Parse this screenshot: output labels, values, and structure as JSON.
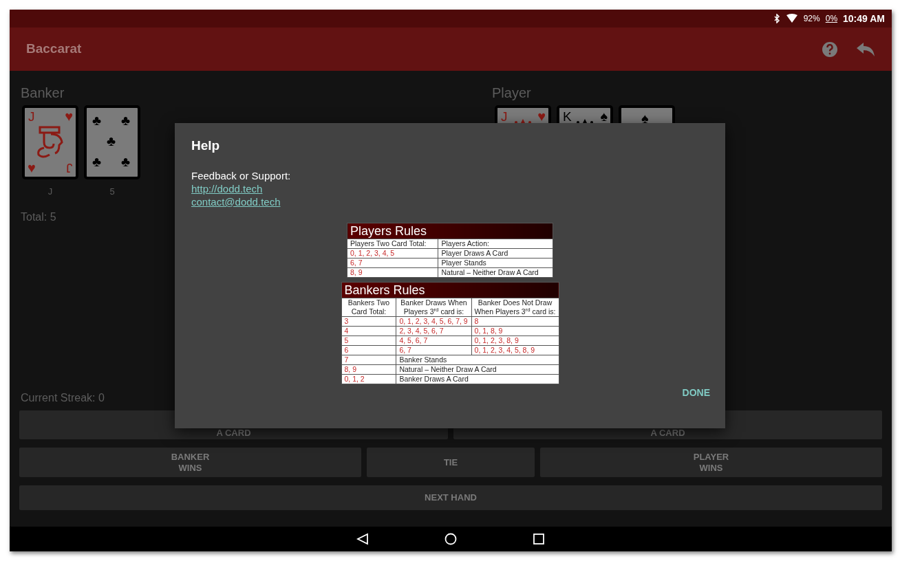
{
  "status_bar": {
    "battery": "92%",
    "data_usage": "0%",
    "time": "10:49 AM"
  },
  "app_bar": {
    "title": "Baccarat"
  },
  "banker": {
    "label": "Banker",
    "cards": [
      {
        "kind": "face",
        "rank": "J",
        "rank_bottom": "J",
        "suit": "♥",
        "color": "#8b1a14",
        "caption": "J"
      },
      {
        "kind": "five",
        "suit": "♣",
        "color": "#000000",
        "caption": "5"
      }
    ],
    "total": "Total: 5"
  },
  "player": {
    "label": "Player",
    "cards": [
      {
        "kind": "face",
        "rank": "J",
        "suit": "♥",
        "color": "#8b1a14"
      },
      {
        "kind": "face",
        "rank": "K",
        "suit": "♠",
        "color": "#000000"
      },
      {
        "kind": "pip",
        "suit": "♠",
        "color": "#000000"
      }
    ]
  },
  "streak": "Current Streak: 0",
  "button_rows": [
    [
      {
        "label": "A CARD",
        "covered": true
      },
      {
        "label": "A CARD",
        "covered": true
      }
    ],
    [
      {
        "label": "BANKER\nWINS",
        "covered": false
      },
      {
        "label": "TIE",
        "covered": false
      },
      {
        "label": "PLAYER\nWINS",
        "covered": false
      }
    ],
    [
      {
        "label": "NEXT HAND",
        "covered": false
      }
    ]
  ],
  "dialog": {
    "title": "Help",
    "feedback_label": "Feedback or Support:",
    "links": [
      "http://dodd.tech",
      "contact@dodd.tech"
    ],
    "players_rules": {
      "title": "Players Rules",
      "columns": [
        "Players Two Card Total:",
        "Players Action:"
      ],
      "rows": [
        [
          "0, 1, 2, 3, 4, 5",
          "Player Draws A Card"
        ],
        [
          "6, 7",
          "Player Stands"
        ],
        [
          "8, 9",
          "Natural – Neither Draw A Card"
        ]
      ]
    },
    "bankers_rules": {
      "title": "Bankers Rules",
      "columns": [
        "Bankers Two Card Total:",
        "Banker Draws When Players 3$^{rd}$ card is:",
        "Banker Does Not Draw When Players 3$^{rd}$ card is:"
      ],
      "rows": [
        [
          "3",
          "0, 1, 2, 3, 4, 5, 6, 7, 9",
          "8"
        ],
        [
          "4",
          "2, 3, 4, 5, 6, 7",
          "0, 1, 8, 9"
        ],
        [
          "5",
          "4, 5, 6, 7",
          "0, 1, 2, 3, 8, 9"
        ],
        [
          "6",
          "6, 7",
          "0, 1, 2, 3, 4, 5, 8, 9"
        ],
        [
          "7",
          {
            "text": "Banker Stands",
            "colspan": 2
          }
        ],
        [
          "8, 9",
          {
            "text": "Natural – Neither Draw A Card",
            "colspan": 2
          }
        ],
        [
          "0, 1, 2",
          {
            "text": "Banker Draws A Card",
            "colspan": 2
          }
        ]
      ]
    },
    "done": "DONE"
  }
}
